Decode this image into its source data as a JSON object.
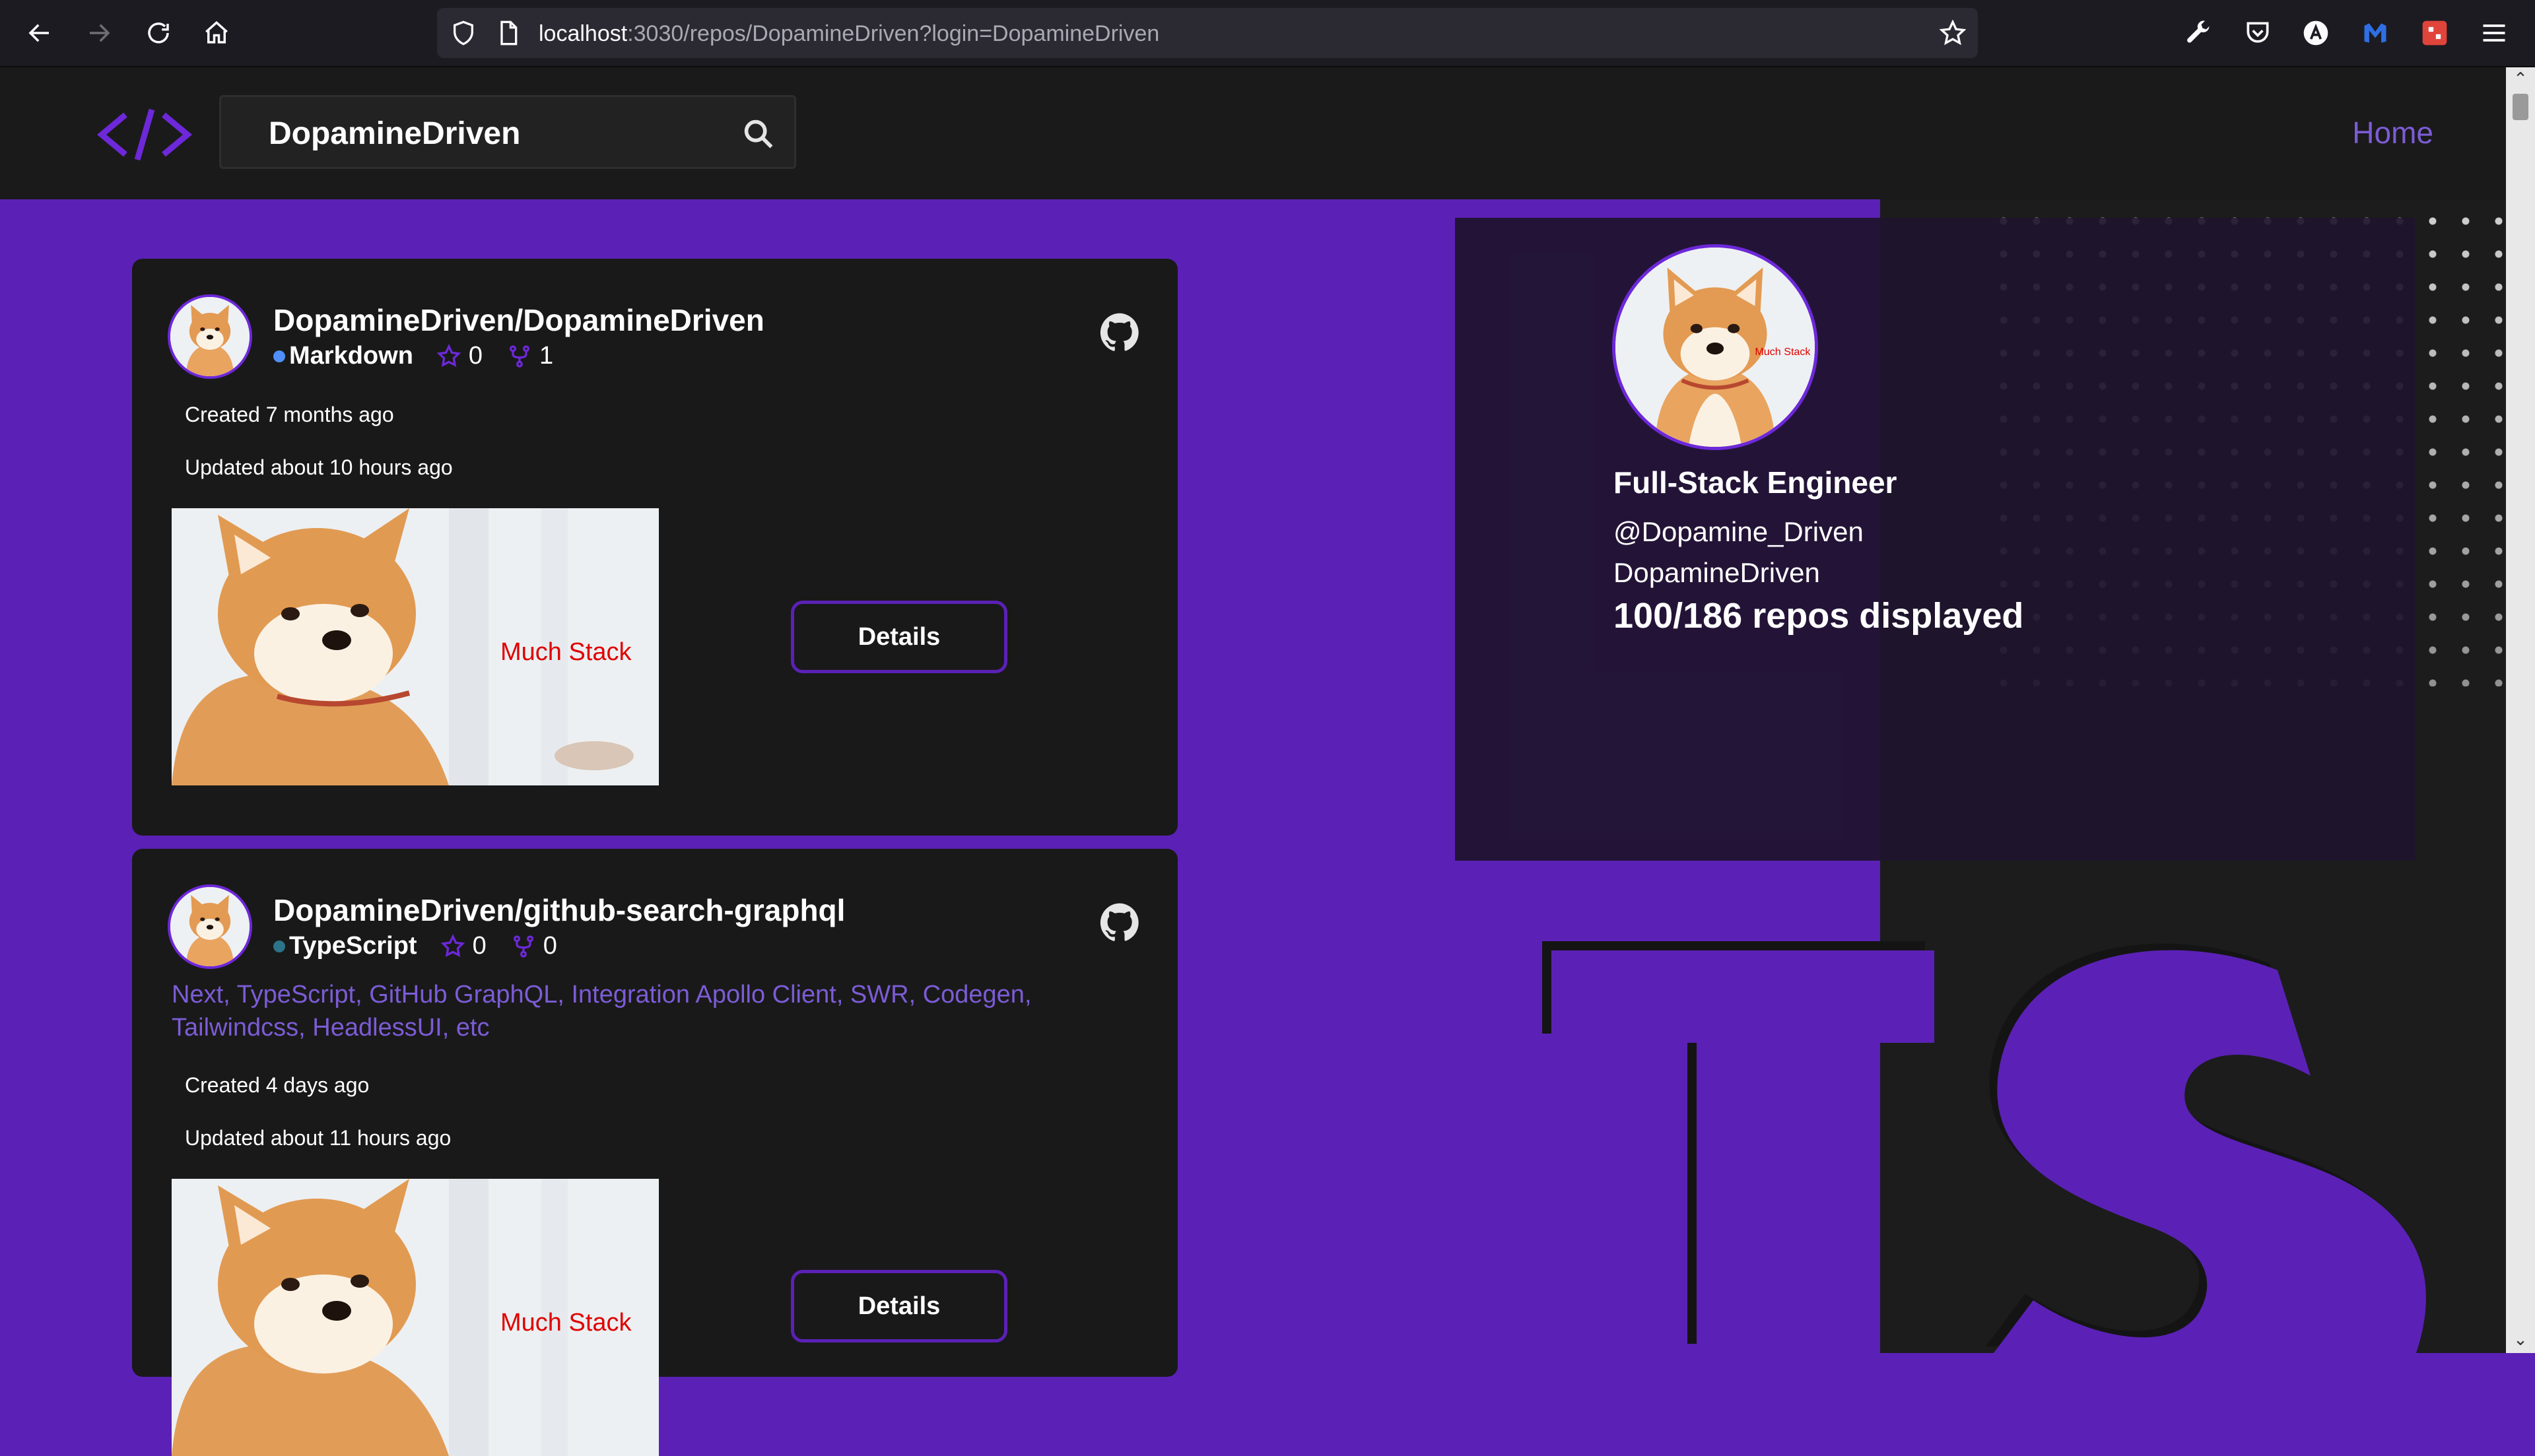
{
  "browser": {
    "url_host": "localhost",
    "url_rest": ":3030/repos/DopamineDriven?login=DopamineDriven"
  },
  "header": {
    "search_value": "DopamineDriven",
    "home_label": "Home"
  },
  "profile": {
    "title": "Full-Stack Engineer",
    "handle": "@Dopamine_Driven",
    "login": "DopamineDriven",
    "repo_count": "100/186 repos displayed",
    "avatar_caption": "Much Stack"
  },
  "repos": [
    {
      "name": "DopamineDriven/DopamineDriven",
      "language": "Markdown",
      "language_color": "#4f8ff7",
      "stars": "0",
      "forks": "1",
      "description": "",
      "created": "Created 7 months ago",
      "updated": "Updated about 10 hours ago",
      "image_caption": "Much Stack",
      "details_label": "Details"
    },
    {
      "name": "DopamineDriven/github-search-graphql",
      "language": "TypeScript",
      "language_color": "#2b7489",
      "stars": "0",
      "forks": "0",
      "description": "Next, TypeScript, GitHub GraphQL, Integration Apollo Client, SWR, Codegen, Tailwindcss, HeadlessUI, etc",
      "created": "Created 4 days ago",
      "updated": "Updated about 11 hours ago",
      "image_caption": "Much Stack",
      "details_label": "Details"
    }
  ],
  "decoration": {
    "ts_letters": "TS"
  },
  "colors": {
    "brand_purple": "#5b21b6",
    "accent_purple": "#7c5cd6",
    "card_bg": "#191919"
  }
}
